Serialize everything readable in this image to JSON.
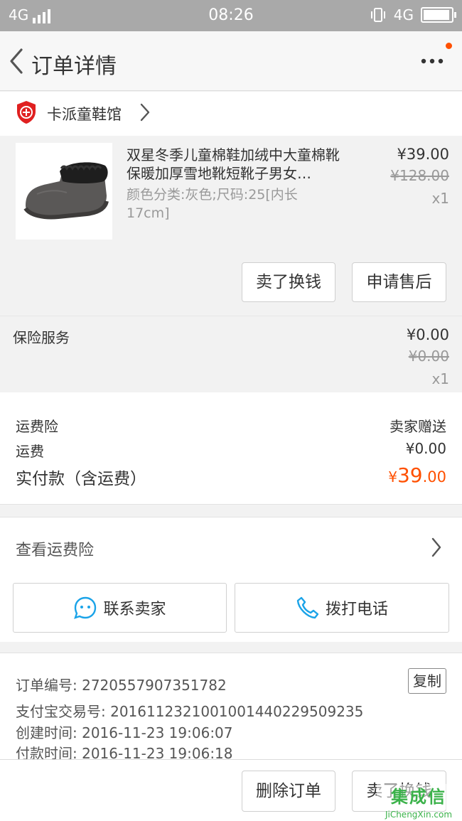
{
  "status_bar": {
    "left_network": "4G",
    "time": "08:26",
    "right_network": "4G"
  },
  "nav": {
    "title": "订单详情"
  },
  "shop": {
    "name": "卡派童鞋馆"
  },
  "product": {
    "name": "双星冬季儿童棉鞋加绒中大童棉靴保暖加厚雪地靴短靴子男女…",
    "sku": "颜色分类:灰色;尺码:25[内长17cm]",
    "price": "¥39.00",
    "original_price": "¥128.00",
    "quantity": "x1",
    "actions": {
      "sell": "卖了换钱",
      "after_sale": "申请售后"
    }
  },
  "insurance_service": {
    "label": "保险服务",
    "price": "¥0.00",
    "original_price": "¥0.00",
    "quantity": "x1"
  },
  "fees": {
    "shipping_insurance_label": "运费险",
    "shipping_insurance_value": "卖家赠送",
    "shipping_label": "运费",
    "shipping_value": "¥0.00",
    "paid_label": "实付款（含运费）",
    "paid_currency": "¥",
    "paid_integer": "39",
    "paid_decimal": ".00"
  },
  "view_insurance": {
    "label": "查看运费险"
  },
  "contact": {
    "seller": "联系卖家",
    "call": "拨打电话"
  },
  "order_info": {
    "order_no": "订单编号: 2720557907351782",
    "alipay_no": "支付宝交易号: 2016112321001001440229509235",
    "created": "创建时间: 2016-11-23 19:06:07",
    "paid": "付款时间: 2016-11-23 19:06:18",
    "copy_label": "复制"
  },
  "bottom_actions": {
    "delete": "删除订单",
    "sell": "卖了换钱"
  },
  "watermark": {
    "text": "集成信",
    "domain": "JiChengXin.com"
  },
  "colors": {
    "accent": "#ff5000",
    "status_bar": "#a9a9a9",
    "contact_icon": "#1aa3e8",
    "watermark": "#3bb24a"
  }
}
